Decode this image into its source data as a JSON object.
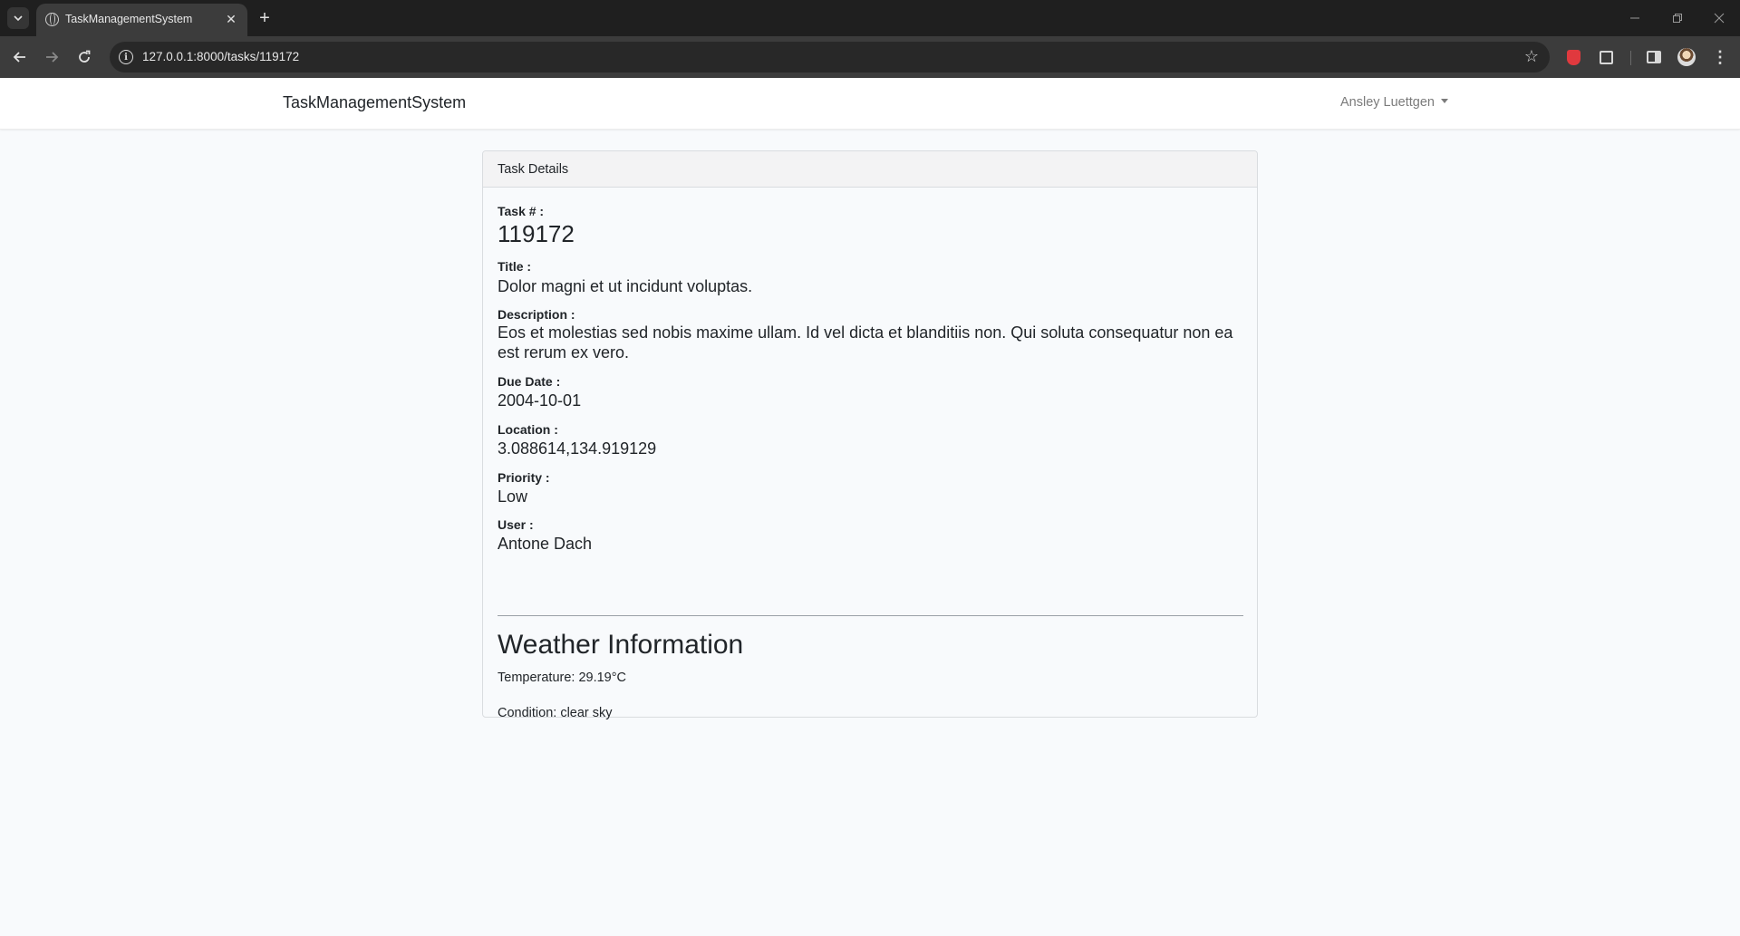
{
  "browser": {
    "tab_title": "TaskManagementSystem",
    "url": "127.0.0.1:8000/tasks/119172",
    "tab_close_glyph": "✕",
    "new_tab_glyph": "+",
    "icons": [
      "tab-list-icon",
      "globe-icon",
      "back-icon",
      "forward-icon",
      "reload-icon",
      "site-info-icon",
      "star-icon",
      "extension-icon",
      "puzzle-icon",
      "side-panel-icon",
      "profile-avatar",
      "kebab-menu-icon"
    ]
  },
  "navbar": {
    "brand": "TaskManagementSystem",
    "user": "Ansley Luettgen"
  },
  "card": {
    "header": "Task Details",
    "fields": {
      "task_no": {
        "label": "Task # :",
        "value": "119172"
      },
      "title": {
        "label": "Title :",
        "value": "Dolor magni et ut incidunt voluptas."
      },
      "description": {
        "label": "Description :",
        "value": "Eos et molestias sed nobis maxime ullam. Id vel dicta et blanditiis non. Qui soluta consequatur non ea est rerum ex vero."
      },
      "due_date": {
        "label": "Due Date :",
        "value": "2004-10-01"
      },
      "location": {
        "label": "Location :",
        "value": "3.088614,134.919129"
      },
      "priority": {
        "label": "Priority :",
        "value": "Low"
      },
      "user": {
        "label": "User :",
        "value": "Antone Dach"
      }
    },
    "weather": {
      "title": "Weather Information",
      "temperature": "Temperature: 29.19°C",
      "condition": "Condition: clear sky"
    }
  },
  "colors": {
    "page_bg": "#f8fafc",
    "tabbar_bg": "#1f1f1f",
    "toolbar_bg": "#3c3c3c",
    "text": "#212529",
    "muted": "#7b7b7b"
  }
}
